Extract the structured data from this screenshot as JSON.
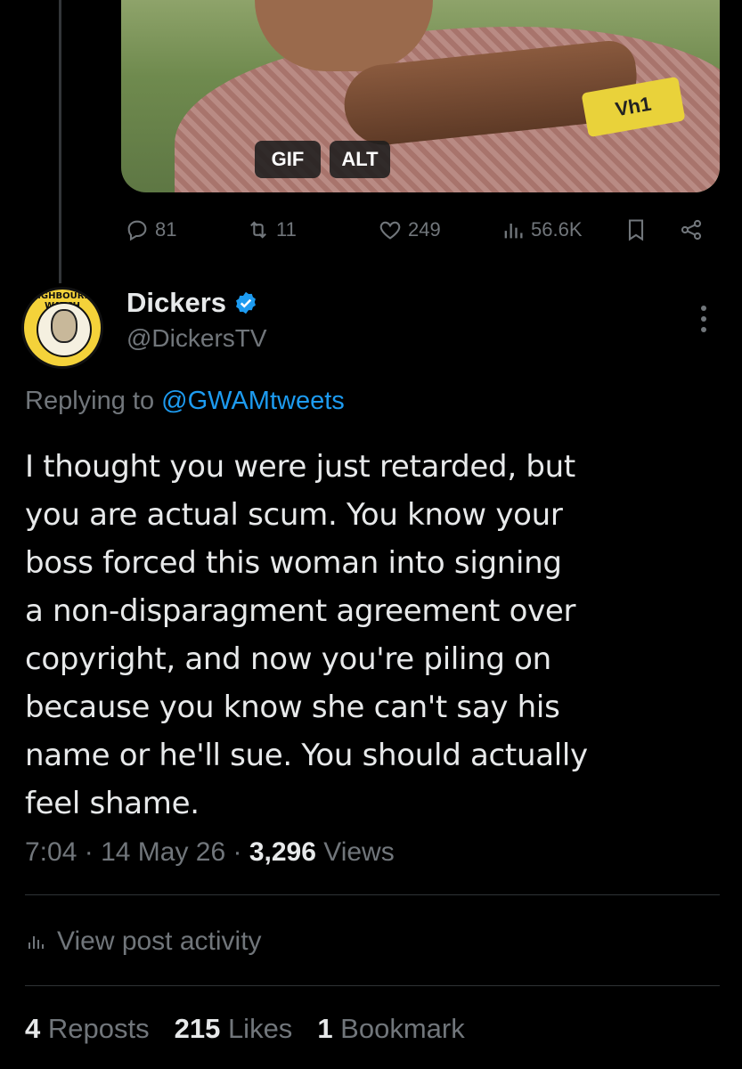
{
  "media": {
    "gif_label": "GIF",
    "alt_label": "ALT",
    "logo_text": "Vh1"
  },
  "parent_actions": {
    "replies": "81",
    "reposts": "11",
    "likes": "249",
    "views": "56.6K"
  },
  "tweet": {
    "display_name": "Dickers",
    "handle": "@DickersTV",
    "avatar_text": "NEIGHBOURHOOD WATCH",
    "replying_prefix": "Replying to ",
    "replying_to": "@GWAMtweets",
    "text": "I thought you were just retarded, but\nyou are actual scum. You know your\nboss forced this woman into signing\na non-disparagment agreement over\ncopyright, and now you're piling on\nbecause you know she can't say his\nname or he'll sue. You should actually\nfeel shame.",
    "time": "7:04",
    "sep1": " · ",
    "date": "14 May 26",
    "sep2": " · ",
    "views_count": "3,296",
    "views_label": " Views"
  },
  "activity_label": "View post activity",
  "stats": {
    "reposts_count": "4",
    "reposts_label": " Reposts",
    "likes_count": "215",
    "likes_label": " Likes",
    "bookmarks_count": "1",
    "bookmarks_label": " Bookmark"
  },
  "colors": {
    "background": "#000000",
    "text": "#e7e9ea",
    "muted": "#71767b",
    "link": "#1d9bf0",
    "verified": "#1d9bf0"
  }
}
